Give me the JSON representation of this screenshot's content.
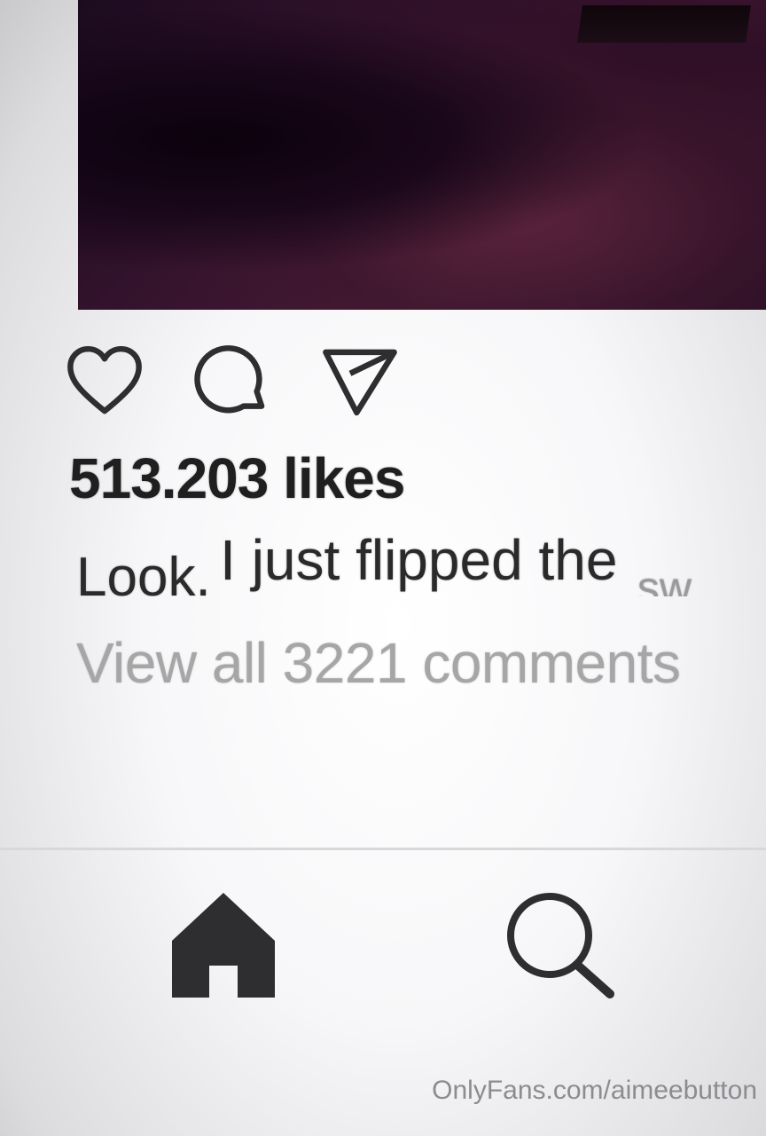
{
  "post": {
    "likes": "513.203 likes",
    "caption": {
      "part1": "Look.",
      "part2": "I just flipped the",
      "part3": "sw"
    },
    "view_comments": "View all 3221 comments"
  },
  "icons": {
    "like": "heart-icon",
    "comment": "comment-icon",
    "share": "send-icon",
    "nav_home": "home-icon",
    "nav_search": "search-icon"
  },
  "watermark": "OnlyFans.com/aimeebutton",
  "colors": {
    "text_dark": "#1f1f1f",
    "text_muted": "#a6a6a6",
    "icon": "#2e2e30"
  }
}
